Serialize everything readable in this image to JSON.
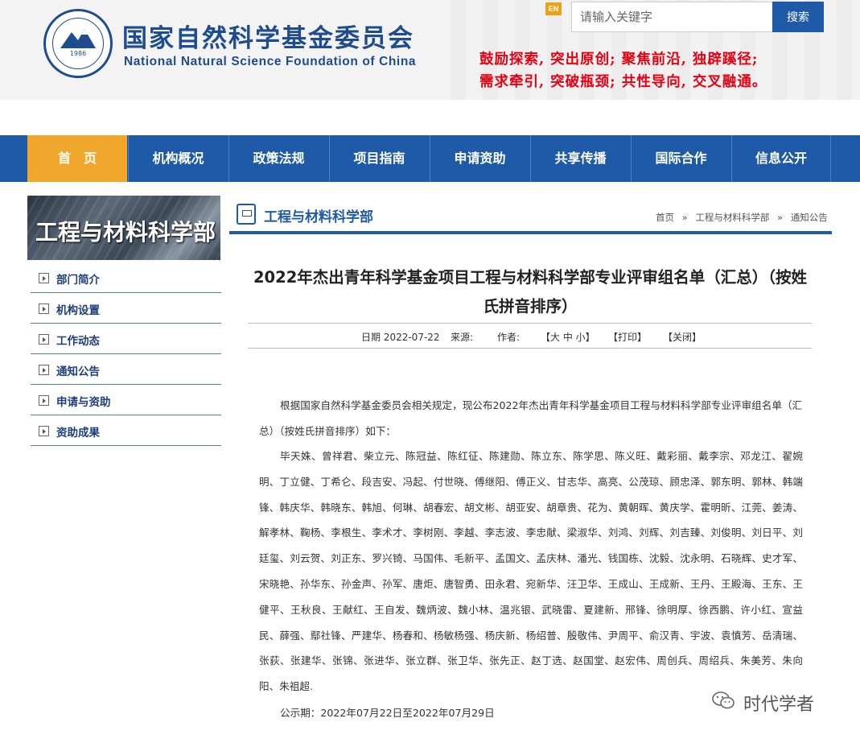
{
  "header": {
    "title_cn": "国家自然科学基金委员会",
    "title_en": "National Natural Science Foundation of China",
    "logo_year": "1986",
    "en_label": "EN",
    "search_placeholder": "请输入关键字",
    "search_button": "搜索",
    "slogan_line1": "鼓励探索, 突出原创; 聚焦前沿, 独辟蹊径;",
    "slogan_line2": "需求牵引, 突破瓶颈; 共性导向, 交叉融通。"
  },
  "nav": {
    "items": [
      {
        "label": "首　页"
      },
      {
        "label": "机构概况"
      },
      {
        "label": "政策法规"
      },
      {
        "label": "项目指南"
      },
      {
        "label": "申请资助"
      },
      {
        "label": "共享传播"
      },
      {
        "label": "国际合作"
      },
      {
        "label": "信息公开"
      }
    ]
  },
  "sidebar": {
    "banner": "工程与材料科学部",
    "items": [
      {
        "label": "部门简介"
      },
      {
        "label": "机构设置"
      },
      {
        "label": "工作动态"
      },
      {
        "label": "通知公告"
      },
      {
        "label": "申请与资助"
      },
      {
        "label": "资助成果"
      }
    ]
  },
  "content": {
    "dept_title": "工程与材料科学部",
    "breadcrumb": [
      "首页",
      "工程与材料科学部",
      "通知公告"
    ],
    "breadcrumb_sep": "»",
    "title": "2022年杰出青年科学基金项目工程与材料科学部专业评审组名单（汇总）（按姓氏拼音排序）",
    "meta": {
      "date": "日期 2022-07-22",
      "source": "来源:",
      "author": "作者:",
      "font_size": "【大 中 小】",
      "print": "【打印】",
      "close": "【关闭】"
    },
    "intro": "根据国家自然科学基金委员会相关规定，现公布2022年杰出青年科学基金项目工程与材料科学部专业评审组名单（汇总）（按姓氏拼音排序）如下：",
    "names": "毕天姝、曾祥君、柴立元、陈冠益、陈红征、陈建勋、陈立东、陈学思、陈义旺、戴彩丽、戴李宗、邓龙江、翟婉明、丁立健、丁希仑、段吉安、冯起、付世晓、傅继阳、傅正义、甘志华、高亮、公茂琼、顾忠泽、郭东明、郭林、韩端锋、韩庆华、韩晓东、韩旭、何琳、胡春宏、胡文彬、胡亚安、胡章贵、花为、黄朝晖、黄庆学、霍明昕、江莞、姜涛、解孝林、鞠杨、李根生、李术才、李树刚、李越、李志波、李忠献、梁淑华、刘鸿、刘辉、刘吉臻、刘俊明、刘日平、刘廷玺、刘云贺、刘正东、罗兴锜、马国伟、毛新平、孟国文、孟庆林、潘光、钱国栋、沈毅、沈永明、石晓辉、史才军、宋晓艳、孙华东、孙金声、孙军、唐炬、唐智勇、田永君、宛新华、汪卫华、王成山、王成新、王丹、王殿海、王东、王健平、王秋良、王献红、王自发、魏炳波、魏小林、温兆银、武晓雷、夏建新、邢锋、徐明厚、徐西鹏、许小红、宣益民、薛强、鄢社锋、严建华、杨春和、杨敏杨强、杨庆新、杨绍普、殷敬伟、尹周平、俞汉青、宇波、袁慎芳、岳清瑞、张荻、张建华、张锦、张进华、张立群、张卫华、张先正、赵丁选、赵国堂、赵宏伟、周创兵、周绍兵、朱美芳、朱向阳、朱祖超.",
    "publicity": "公示期：2022年07月22日至2022年07月29日"
  },
  "watermark": {
    "text": "时代学者"
  }
}
